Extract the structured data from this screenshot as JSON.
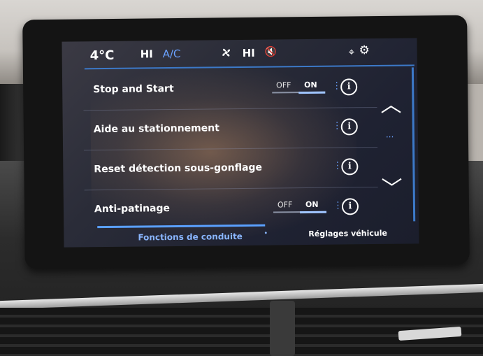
{
  "status_bar": {
    "temperature": "4°C",
    "fan_mode": "HI",
    "ac_label": "A/C",
    "fan_speed": "HI",
    "icons": [
      "fan-icon",
      "mute-icon",
      "location-pin-icon",
      "gear-icon"
    ],
    "accent_color": "#3c79c8"
  },
  "settings": [
    {
      "label": "Stop and Start",
      "toggle": {
        "off": "OFF",
        "on": "ON",
        "state": "on"
      },
      "info": "i"
    },
    {
      "label": "Aide au stationnement",
      "info": "i"
    },
    {
      "label": "Reset détection sous-gonflage",
      "info": "i"
    },
    {
      "label": "Anti-patinage",
      "toggle": {
        "off": "OFF",
        "on": "ON",
        "state": "on"
      },
      "info": "i"
    }
  ],
  "navigation": {
    "scroll_up": "︿",
    "scroll_down": "﹀"
  },
  "tabs": [
    {
      "label": "Fonctions de conduite",
      "active": true
    },
    {
      "label": "Réglages véhicule",
      "active": false
    }
  ]
}
